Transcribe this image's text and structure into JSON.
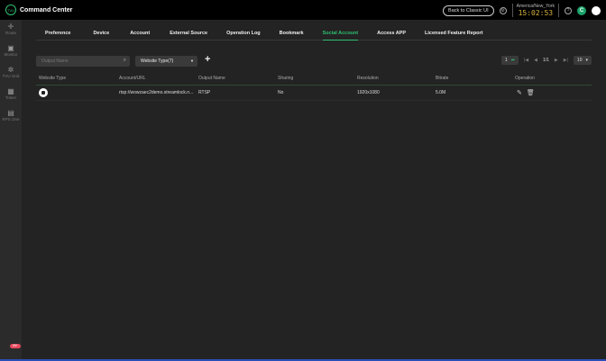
{
  "header": {
    "logo_text": "TVU",
    "title": "Command Center",
    "back_classic": "Back to Classic UI",
    "timezone": "America/New_York",
    "time": "15:02:53",
    "avatar": "C"
  },
  "sidebar": {
    "items": [
      {
        "label": "Route",
        "icon": "route-icon"
      },
      {
        "label": "Monitor",
        "icon": "monitor-icon"
      },
      {
        "label": "TVU Grid",
        "icon": "grid-icon"
      },
      {
        "label": "Token",
        "icon": "token-icon"
      },
      {
        "label": "RPS One",
        "icon": "rps-icon"
      }
    ],
    "badge": "99+"
  },
  "tabs": [
    "Preference",
    "Device",
    "Account",
    "External Source",
    "Operation Log",
    "Bookmark",
    "Social Account",
    "Access APP",
    "Licensed Feature Report"
  ],
  "active_tab": "Social Account",
  "toolbar": {
    "search_placeholder": "Output Name",
    "website_type": "Website Type(7)"
  },
  "pagination": {
    "page_input": "1",
    "page_info": "1/1",
    "page_size": "10"
  },
  "table": {
    "columns": [
      "Website Type",
      "Account/URL",
      "Output Name",
      "Sharing",
      "Resolution",
      "Bitrate",
      "Operation"
    ],
    "rows": [
      {
        "url": "rtsp://wowzaec2demo.streamlock.n...",
        "output": "RTSP",
        "sharing": "No",
        "resolution": "1920x1080",
        "bitrate": "5.0M"
      }
    ]
  }
}
